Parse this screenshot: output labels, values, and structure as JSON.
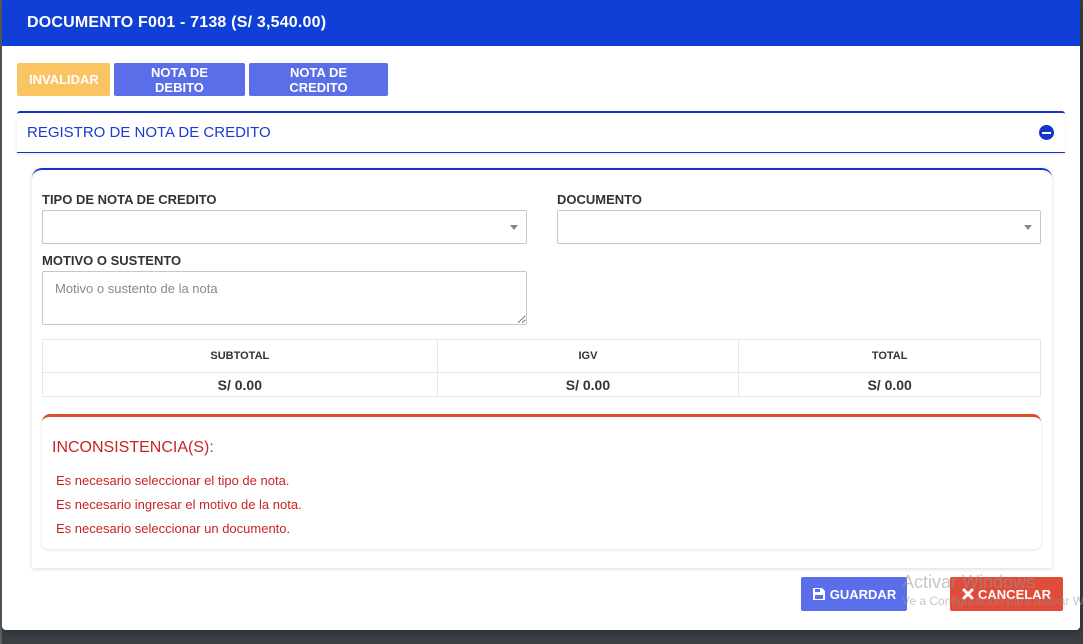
{
  "modal": {
    "title": "DOCUMENTO F001 - 7138 (S/ 3,540.00)"
  },
  "actions": {
    "invalidate": "INVALIDAR",
    "debit_note": "NOTA DE DEBITO",
    "credit_note": "NOTA DE CREDITO"
  },
  "panel": {
    "title": "REGISTRO DE NOTA DE CREDITO"
  },
  "form": {
    "note_type_label": "TIPO DE NOTA DE CREDITO",
    "note_type_value": "",
    "document_label": "DOCUMENTO",
    "document_value": "",
    "reason_label": "MOTIVO O SUSTENTO",
    "reason_value": "",
    "reason_placeholder": "Motivo o sustento de la nota"
  },
  "totals": {
    "headers": [
      "SUBTOTAL",
      "IGV",
      "TOTAL"
    ],
    "values": [
      "S/ 0.00",
      "S/ 0.00",
      "S/ 0.00"
    ]
  },
  "alert": {
    "title": "INCONSISTENCIA(S):",
    "messages": [
      "Es necesario seleccionar el tipo de nota.",
      "Es necesario ingresar el motivo de la nota.",
      "Es necesario seleccionar un documento."
    ]
  },
  "footer": {
    "save_label": "GUARDAR",
    "cancel_label": "CANCELAR",
    "save_icon": "floppy-icon",
    "cancel_icon": "x-icon"
  },
  "watermark": {
    "line1": "Activar Windows",
    "line2": "Ve a Configuración para activar Windows."
  },
  "colors": {
    "header_blue": "#0f3fd6",
    "primary": "#5b6ee9",
    "warning": "#fbc463",
    "danger": "#e04b3a",
    "error_text": "#c72424"
  }
}
